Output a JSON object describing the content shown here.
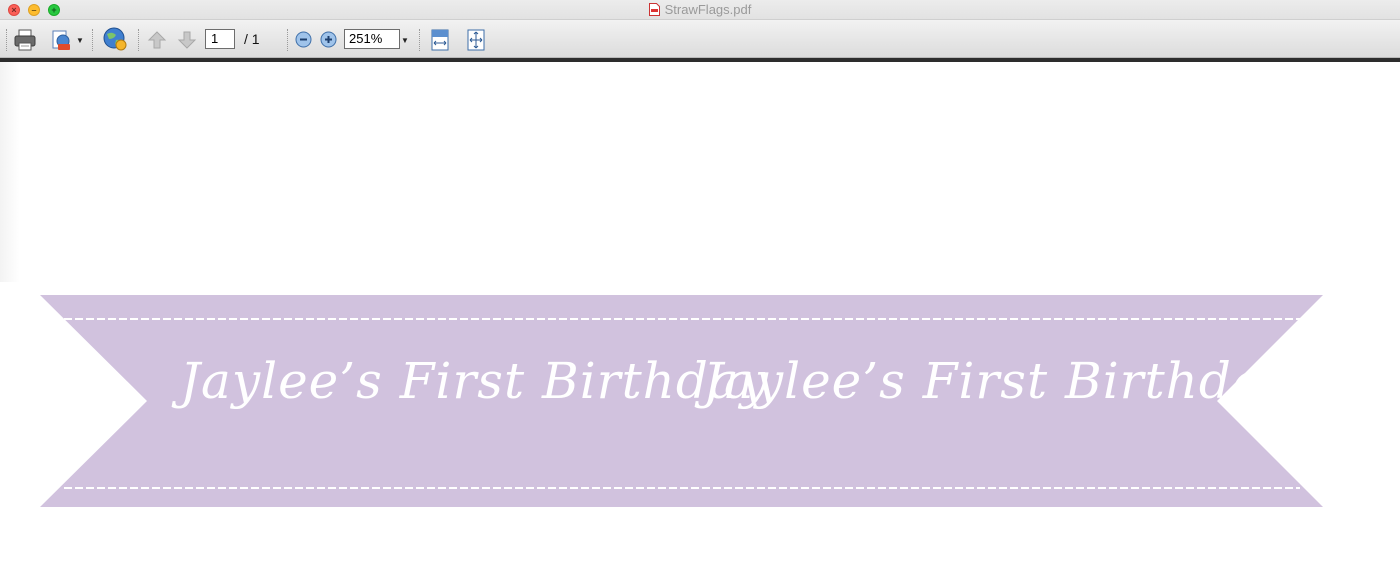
{
  "window": {
    "title": "StrawFlags.pdf",
    "buttons": {
      "close": "×",
      "minimize": "–",
      "maximize": "+"
    }
  },
  "toolbar": {
    "icons": [
      "print-icon",
      "export-icon",
      "globe-icon",
      "page-up-icon",
      "page-down-icon",
      "zoom-out-icon",
      "zoom-in-icon",
      "fit-width-icon",
      "fit-page-icon"
    ],
    "current_page": "1",
    "page_total": "/  1",
    "zoom": "251%"
  },
  "document": {
    "banner_color": "#d1c2de",
    "banner_text_left": "Jaylee’s First Birthday",
    "banner_text_right": "Jaylee’s First Birthday"
  }
}
